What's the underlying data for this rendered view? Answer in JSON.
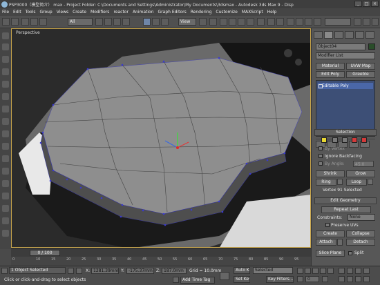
{
  "title_bar": {
    "text": "PSP3000（模型简介） max  - Project Folder: C:\\Documents and Settings\\Administrator\\My Documents\\3dsmax   - Autodesk 3ds Max 9   - Disp",
    "buttons": [
      "_",
      "□",
      "×"
    ]
  },
  "menu": [
    "File",
    "Edit",
    "Tools",
    "Group",
    "Views",
    "Create",
    "Modifiers",
    "reactor",
    "Animation",
    "Graph Editors",
    "Rendering",
    "Customize",
    "MAXScript",
    "Help"
  ],
  "toolbar": {
    "selection_filter": "All",
    "reference_coord": "View",
    "named_selection": ""
  },
  "viewport": {
    "label": "Perspective"
  },
  "command_panel": {
    "object_name": "Object04",
    "modifier_list": "Modifier List",
    "buttons": {
      "material": "Material",
      "uvw_map": "UVW Map",
      "edit_poly": "Edit Poly",
      "greeble": "Greeble"
    },
    "modifier_stack": [
      "Editable Poly"
    ],
    "selection_rollout": "Selection",
    "by_vertex": "By Vertex",
    "ignore_backfacing": "Ignore Backfacing",
    "by_angle": "By Angle:",
    "angle_value": "45.0",
    "shrink": "Shrink",
    "grow": "Grow",
    "ring": "Ring",
    "loop": "Loop",
    "selection_status": "Vertex 91 Selected",
    "edit_geometry_rollout": "Edit Geometry",
    "repeat_last": "Repeat Last",
    "constraints_label": "Constraints:",
    "constraints_value": "None",
    "preserve_uvs": "Preserve UVs",
    "create": "Create",
    "collapse": "Collapse",
    "attach": "Attach",
    "detach": "Detach",
    "slice_plane": "Slice Plane",
    "split": "Split"
  },
  "timeline": {
    "slider_label": "0 / 100",
    "ticks": [
      "0",
      "10",
      "15",
      "20",
      "25",
      "30",
      "35",
      "40",
      "45",
      "50",
      "55",
      "60",
      "65",
      "70",
      "75",
      "80",
      "85",
      "90",
      "95"
    ]
  },
  "status_bar": {
    "selected": "1 Object Selected",
    "prompt": "Click or click-and-drag to select objects",
    "x_label": "X:",
    "x_value": "1281.39mm",
    "y_label": "Y:",
    "y_value": "-175.37mm",
    "z_label": "Z:",
    "z_value": "187.0mm",
    "grid": "Grid = 10.0mm",
    "add_time_tag": "Add Time Tag",
    "auto_key": "Auto Key",
    "set_key": "Set Key",
    "selected_filter": "Selected",
    "key_filters": "Key Filters...",
    "frame": "0"
  }
}
